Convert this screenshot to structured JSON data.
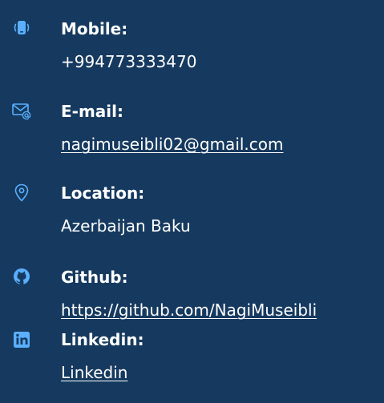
{
  "colors": {
    "background": "#163a5f",
    "text": "#ffffff",
    "icon": "#5ab0ff"
  },
  "contacts": [
    {
      "icon": "phone-icon",
      "label": "Mobile:",
      "value": "+994773333470"
    },
    {
      "icon": "mail-icon",
      "label": "E-mail:",
      "value": "nagimuseibli02@gmail.com"
    },
    {
      "icon": "location-icon",
      "label": "Location:",
      "value": "Azerbaijan Baku"
    },
    {
      "icon": "github-icon",
      "label": "Github:",
      "value": "https://github.com/NagiMuseibli"
    },
    {
      "icon": "linkedin-icon",
      "label": "Linkedin:",
      "value": "Linkedin"
    }
  ]
}
